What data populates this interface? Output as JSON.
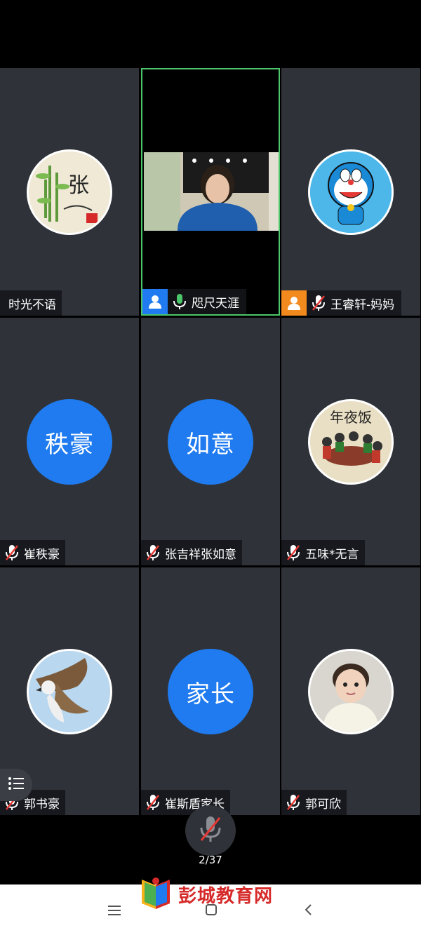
{
  "participants": [
    {
      "name": "时光不语",
      "type": "image-avatar",
      "avatar_icon": "calligraphy-bamboo-avatar",
      "mic": "none"
    },
    {
      "name": "咫尺天涯",
      "type": "video",
      "mic": "on",
      "role": "host",
      "badge_color": "#1f7bef"
    },
    {
      "name": "王睿轩-妈妈",
      "type": "image-avatar",
      "avatar_icon": "doraemon-avatar",
      "mic": "muted",
      "badge_color": "#f28a1d"
    },
    {
      "name": "崔秩豪",
      "type": "text-avatar",
      "avatar_text": "秩豪",
      "mic": "muted"
    },
    {
      "name": "张吉祥张如意",
      "type": "text-avatar",
      "avatar_text": "如意",
      "mic": "muted"
    },
    {
      "name": "五味*无言",
      "type": "image-avatar",
      "avatar_icon": "family-dinner-avatar",
      "avatar_caption": "年夜饭",
      "mic": "muted"
    },
    {
      "name": "郭书豪",
      "type": "image-avatar",
      "avatar_icon": "eagle-avatar",
      "mic": "muted"
    },
    {
      "name": "崔斯盾家长",
      "type": "text-avatar",
      "avatar_text": "家长",
      "mic": "muted"
    },
    {
      "name": "郭可欣",
      "type": "image-avatar",
      "avatar_icon": "child-photo-avatar",
      "mic": "muted"
    }
  ],
  "controls": {
    "page_indicator": "2/37",
    "mute_icon": "mic-muted-icon",
    "list_icon": "participant-list-icon"
  },
  "watermark": {
    "text": "彭城教育网"
  },
  "colors": {
    "accent_blue": "#1f7bef",
    "speaking_border": "#4cc66a",
    "muted_red": "#e53935",
    "tile_bg": "#2f3339"
  }
}
